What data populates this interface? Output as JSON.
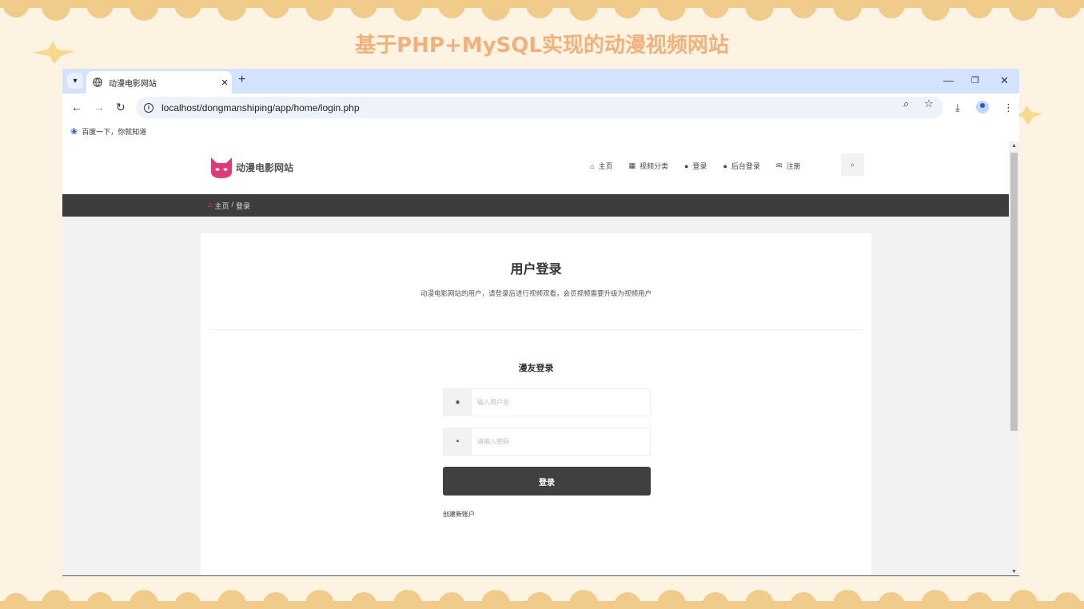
{
  "slide": {
    "title": "基于PHP+MySQL实现的动漫视频网站"
  },
  "browser": {
    "tab_title": "动漫电影网站",
    "url": "localhost/dongmanshiping/app/home/login.php",
    "bookmark_label": "百度一下，你就知道"
  },
  "site": {
    "logo_text": "动漫电影网站",
    "nav": [
      {
        "label": "主页",
        "icon": "home-icon"
      },
      {
        "label": "视频分类",
        "icon": "grid-icon"
      },
      {
        "label": "登录",
        "icon": "user-icon"
      },
      {
        "label": "后台登录",
        "icon": "user-icon"
      },
      {
        "label": "注册",
        "icon": "envelope-icon"
      }
    ],
    "breadcrumb": {
      "home": "主页",
      "separator": "/",
      "current": "登录"
    }
  },
  "login": {
    "title": "用户登录",
    "subtitle": "动漫电影网站的用户，请登录后进行视频观看，会员视频需要升级为视频用户",
    "form_title": "漫友登录",
    "username_placeholder": "输入用户名",
    "password_placeholder": "请输入密码",
    "submit_label": "登录",
    "create_account": "创建新账户"
  },
  "colors": {
    "slide_bg": "#fdf3e3",
    "cloud": "#f0cb8a",
    "title": "#f2b07a",
    "tabbar": "#d3e3fd",
    "dark_bar": "#3d3d3d",
    "logo": "#e03a7a"
  }
}
